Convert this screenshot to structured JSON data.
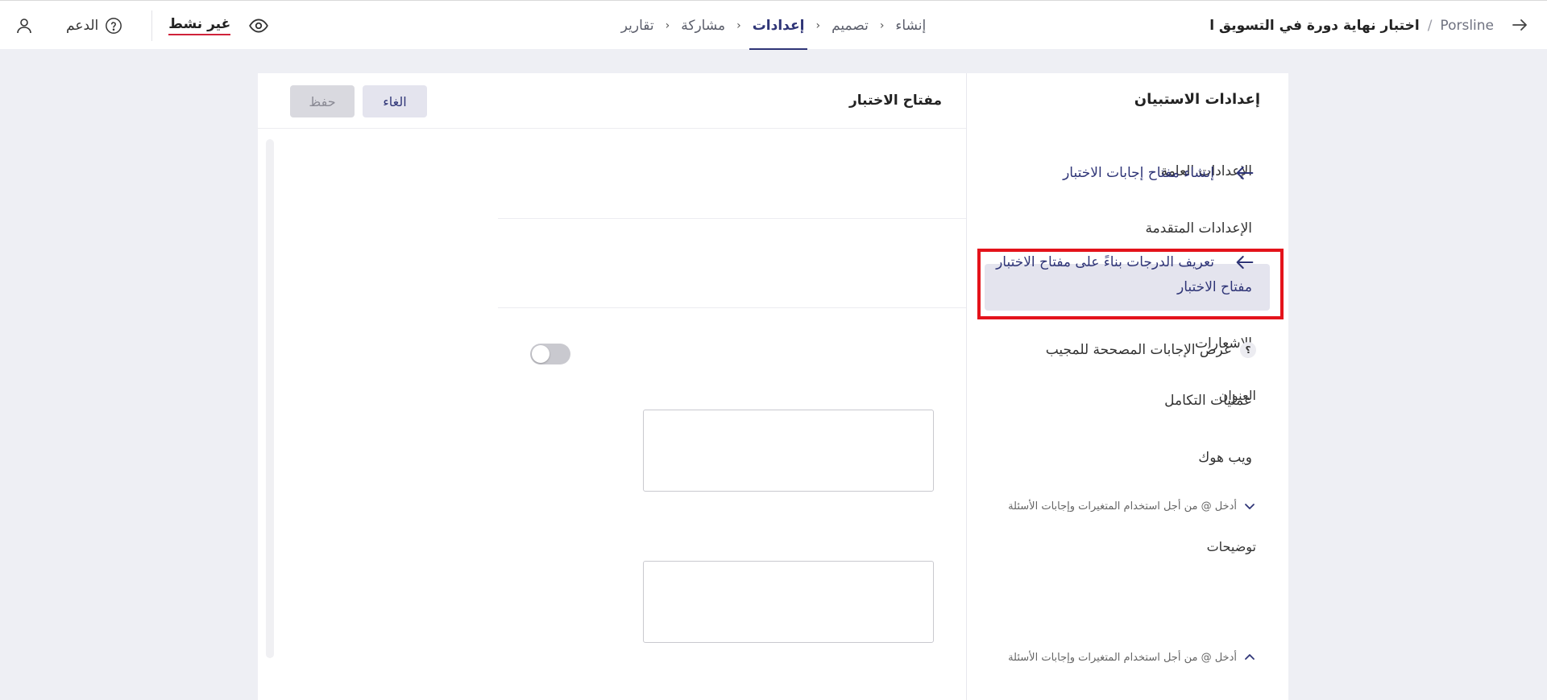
{
  "header": {
    "brand": "Porsline",
    "separator": "/",
    "survey_title": "اختبار نهاية دورة في التسويق ا",
    "steps": [
      "إنشاء",
      "تصميم",
      "إعدادات",
      "مشاركة",
      "تقارير"
    ],
    "active_step": "إعدادات",
    "step_separator": "›",
    "support_label": "الدعم",
    "status_label": "غير نشط"
  },
  "sidebar": {
    "title": "إعدادات الاستبيان",
    "items": [
      {
        "label": "الإعدادات العامة"
      },
      {
        "label": "الإعدادات المتقدمة"
      },
      {
        "label": "مفتاح الاختبار"
      },
      {
        "label": "الإشعارات"
      },
      {
        "label": "عمليات التكامل"
      },
      {
        "label": "ويب هوك"
      }
    ],
    "active_item": "مفتاح الاختبار"
  },
  "content": {
    "title": "مفتاح الاختبار",
    "cancel_label": "الغاء",
    "save_label": "حفظ",
    "links": [
      {
        "label": "إنشاء مفتاح إجابات الاختبار"
      },
      {
        "label": "تعريف الدرجات بناءً على مفتاح الاختبار"
      }
    ],
    "toggle": {
      "label": "عرض الإجابات المصححة للمجيب",
      "help": "؟",
      "enabled": false
    },
    "fields": [
      {
        "label": "العنوان",
        "value": "",
        "hint": "أدخل @ من أجل استخدام المتغيرات وإجابات الأسئلة",
        "hint_icon": "chevron-down-icon"
      },
      {
        "label": "توضيحات",
        "value": "",
        "hint": "أدخل @ من أجل استخدام المتغيرات وإجابات الأسئلة",
        "hint_icon": "chevron-up-icon"
      }
    ]
  },
  "colors": {
    "accent": "#2f3577",
    "highlight": "#e4131b",
    "status_underline": "#d0223a",
    "background": "#eeeff4"
  }
}
